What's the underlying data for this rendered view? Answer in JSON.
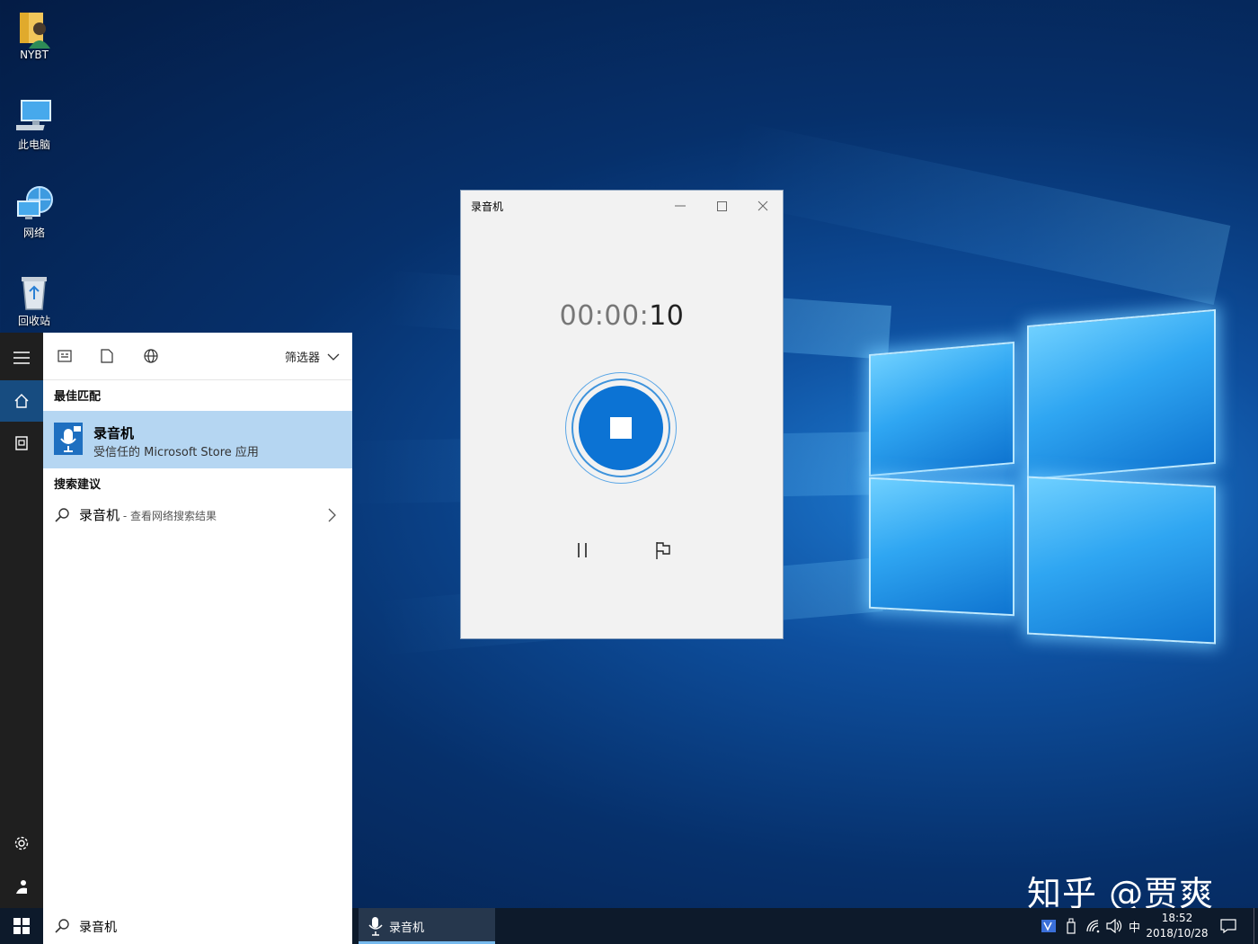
{
  "desktop": {
    "icons": [
      {
        "label": "NYBT"
      },
      {
        "label": "此电脑"
      },
      {
        "label": "网络"
      },
      {
        "label": "回收站"
      }
    ],
    "watermark": "知乎 @贾爽"
  },
  "start": {
    "toolbar": {
      "filter_label": "筛选器"
    },
    "best_match_title": "最佳匹配",
    "best_match": {
      "name": "录音机",
      "subtitle": "受信任的 Microsoft Store 应用"
    },
    "suggestions_title": "搜索建议",
    "suggestion": {
      "name": "录音机",
      "hint": " - 查看网络搜索结果"
    }
  },
  "recorder": {
    "title": "录音机",
    "timer_prefix": "00:00:",
    "timer_seconds": "10"
  },
  "taskbar": {
    "search_value": "录音机",
    "app_label": "录音机",
    "ime": "中",
    "time": "18:52",
    "date": "2018/10/28"
  },
  "colors": {
    "accent": "#0c73d4",
    "selection": "#b5d6f2",
    "taskbar": "#0d1a2b"
  }
}
